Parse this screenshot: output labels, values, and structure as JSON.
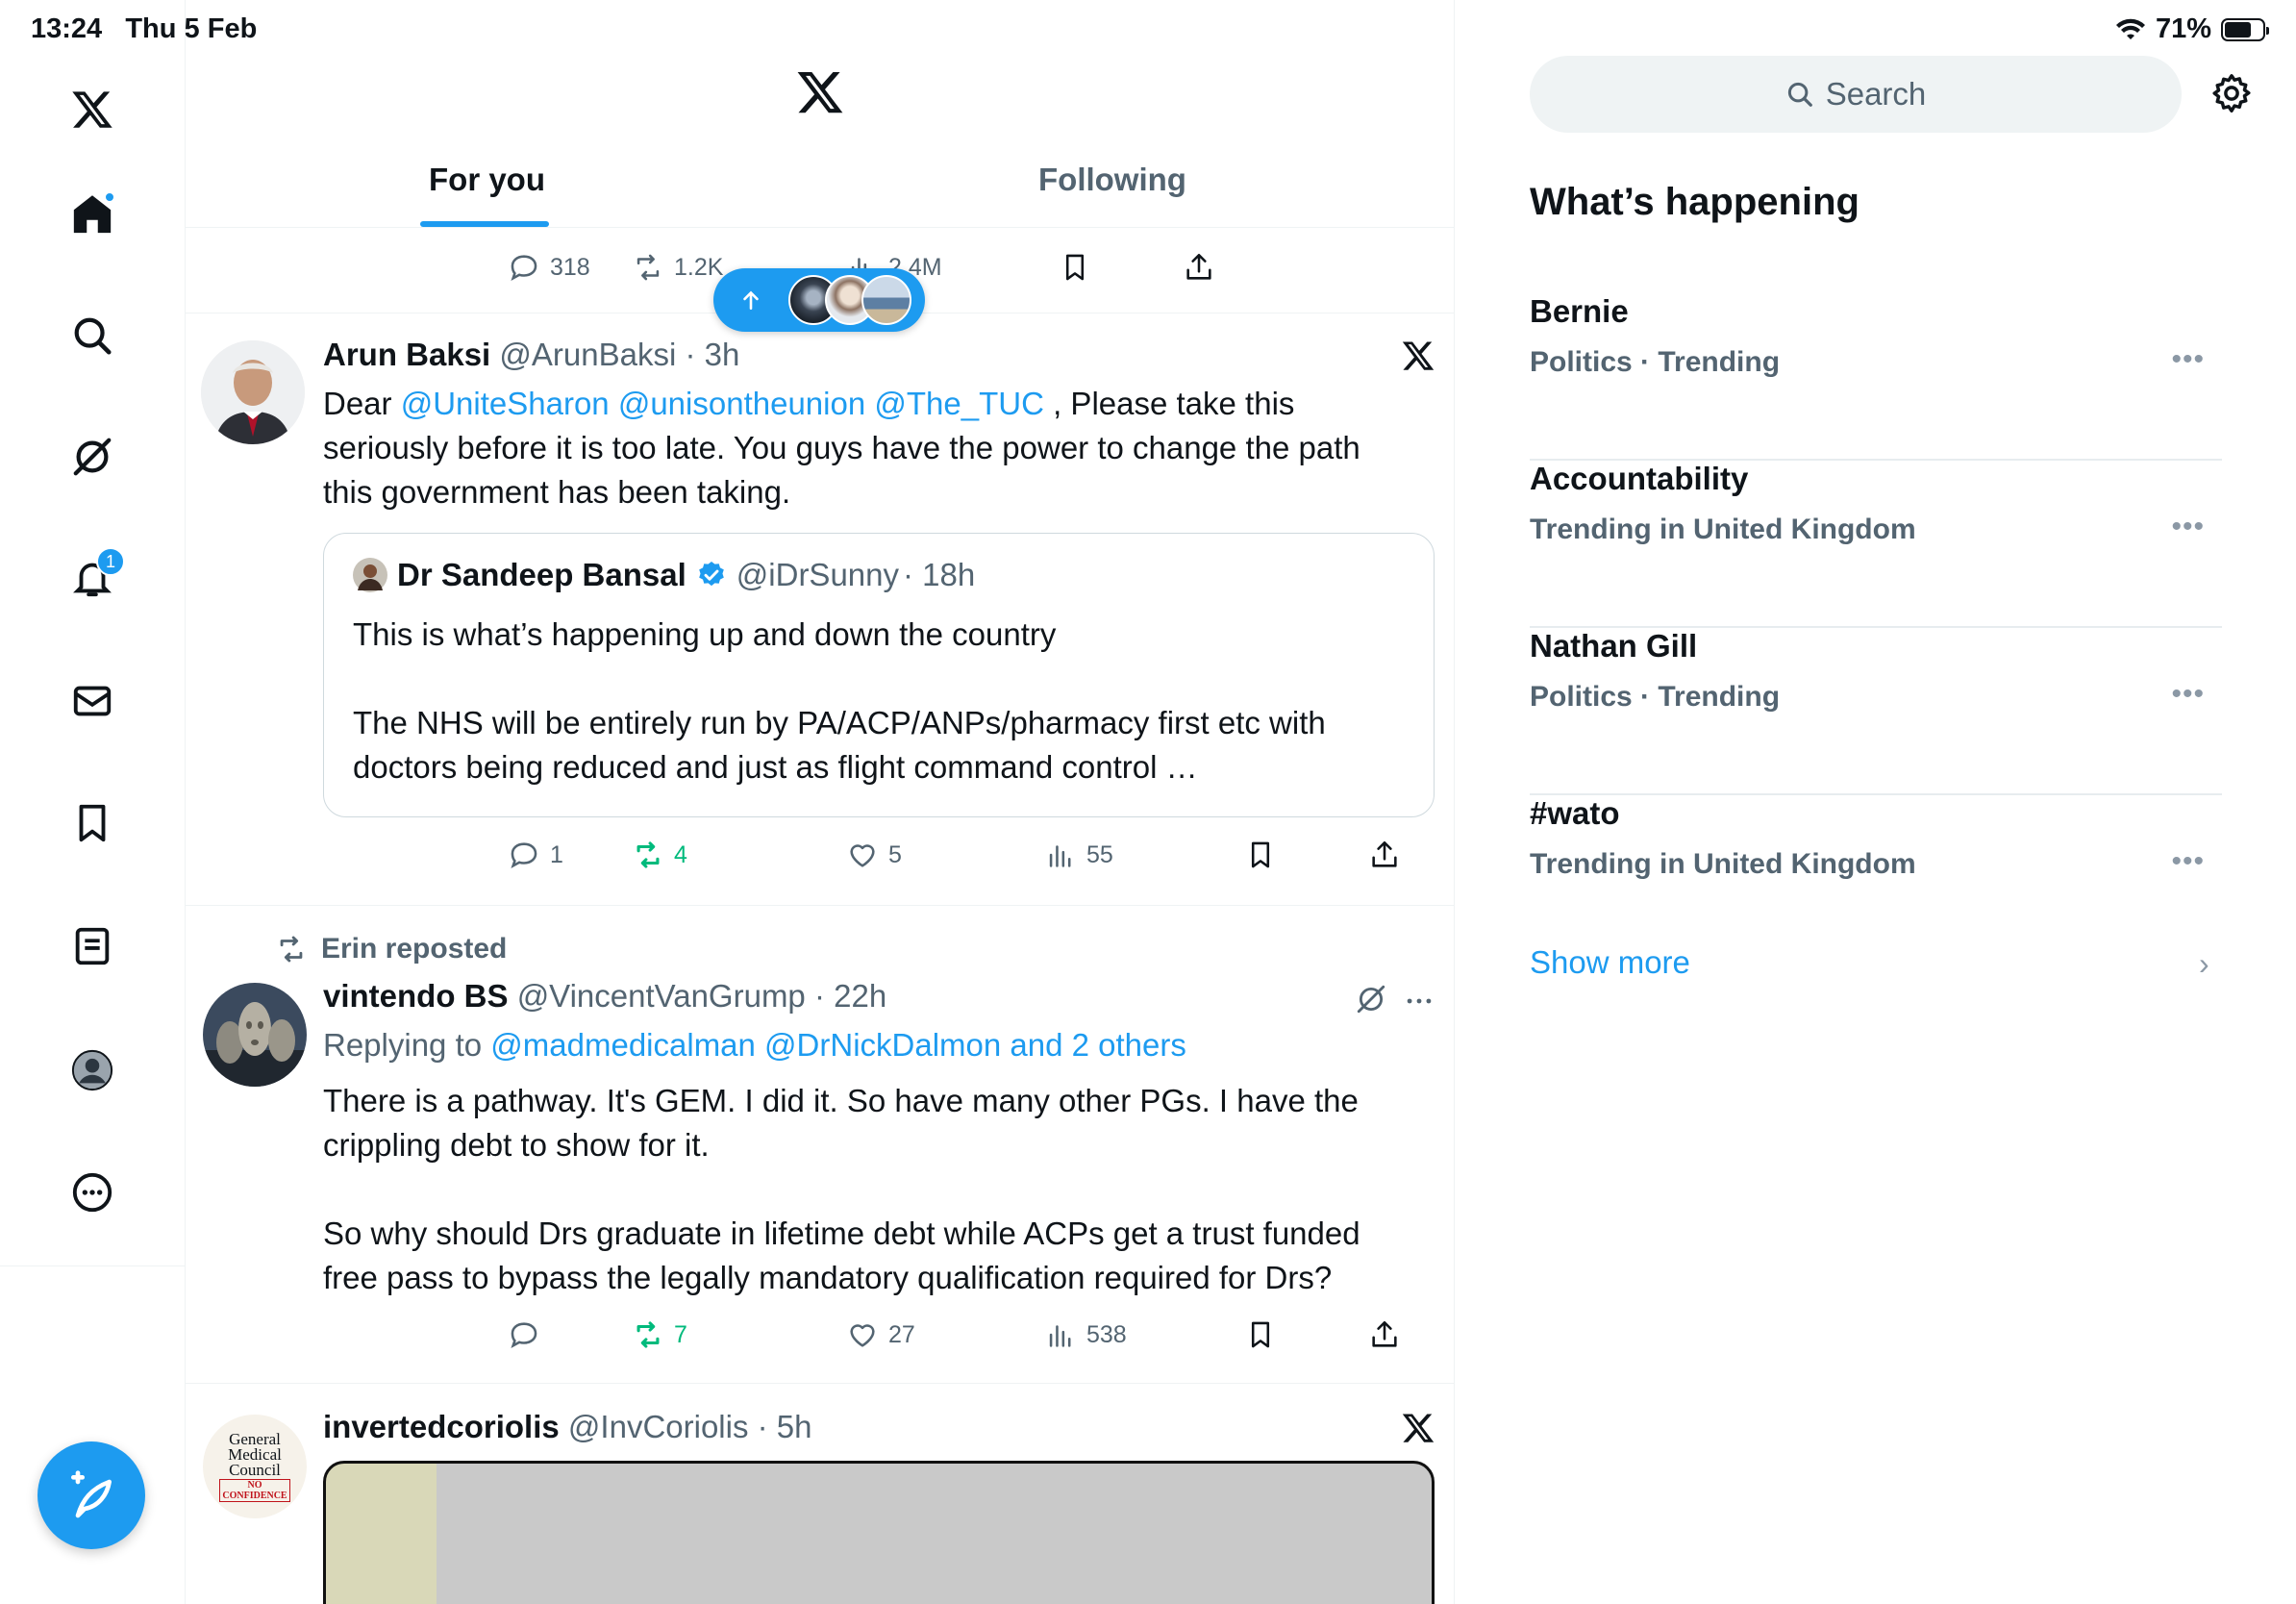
{
  "status": {
    "time": "13:24",
    "date": "Thu 5 Feb",
    "battery": "71%"
  },
  "nav": {
    "notifications_badge": "1"
  },
  "tabs": {
    "for_you": "For you",
    "following": "Following"
  },
  "top_actions": {
    "replies": "318",
    "reposts": "1.2K",
    "views": "2.4M"
  },
  "tweet1": {
    "name": "Arun Baksi",
    "handle": "@ArunBaksi",
    "time": "· 3h",
    "body_pre": "Dear",
    "mentions": [
      "@UniteSharon",
      "@unisontheunion",
      "@The_TUC"
    ],
    "body_post": ", Please take this seriously before it is too late. You guys have the power to change the path this government has been taking.",
    "quote": {
      "name": "Dr Sandeep Bansal",
      "handle": "@iDrSunny",
      "time": "· 18h",
      "line1": "This is what’s happening up and down the country",
      "line2": "The NHS will be entirely run by PA/ACP/ANPs/pharmacy first etc with doctors being reduced and just as flight command control …"
    },
    "replies": "1",
    "reposts": "4",
    "likes": "5",
    "views": "55"
  },
  "tweet2": {
    "reposted_by": "Erin reposted",
    "name": "vintendo BS",
    "handle": "@VincentVanGrump",
    "time": "· 22h",
    "replying_prefix": "Replying to",
    "replying_to": "@madmedicalman @DrNickDalmon and 2 others",
    "para1": "There is a pathway. It's GEM. I did it. So have many other PGs. I have the crippling debt to show for it.",
    "para2": "So why should Drs graduate in lifetime debt while ACPs get a trust funded free pass to bypass the legally mandatory qualification required for Drs?",
    "reposts": "7",
    "likes": "27",
    "views": "538"
  },
  "tweet3": {
    "name": "invertedcoriolis",
    "handle": "@InvCoriolis",
    "time": "· 5h",
    "avatar_text": [
      "General",
      "Medical",
      "Council",
      "NO",
      "CONFIDENCE"
    ]
  },
  "sidebar": {
    "search_placeholder": "Search",
    "title": "What’s happening",
    "trends": [
      {
        "name": "Bernie",
        "meta": "Politics · Trending"
      },
      {
        "name": "Accountability",
        "meta": "Trending in United Kingdom"
      },
      {
        "name": "Nathan Gill",
        "meta": "Politics · Trending"
      },
      {
        "name": "#wato",
        "meta": "Trending in United Kingdom"
      }
    ],
    "show_more": "Show more"
  },
  "colors": {
    "accent": "#1d9bf0",
    "green": "#00ba7c",
    "muted": "#536471"
  }
}
